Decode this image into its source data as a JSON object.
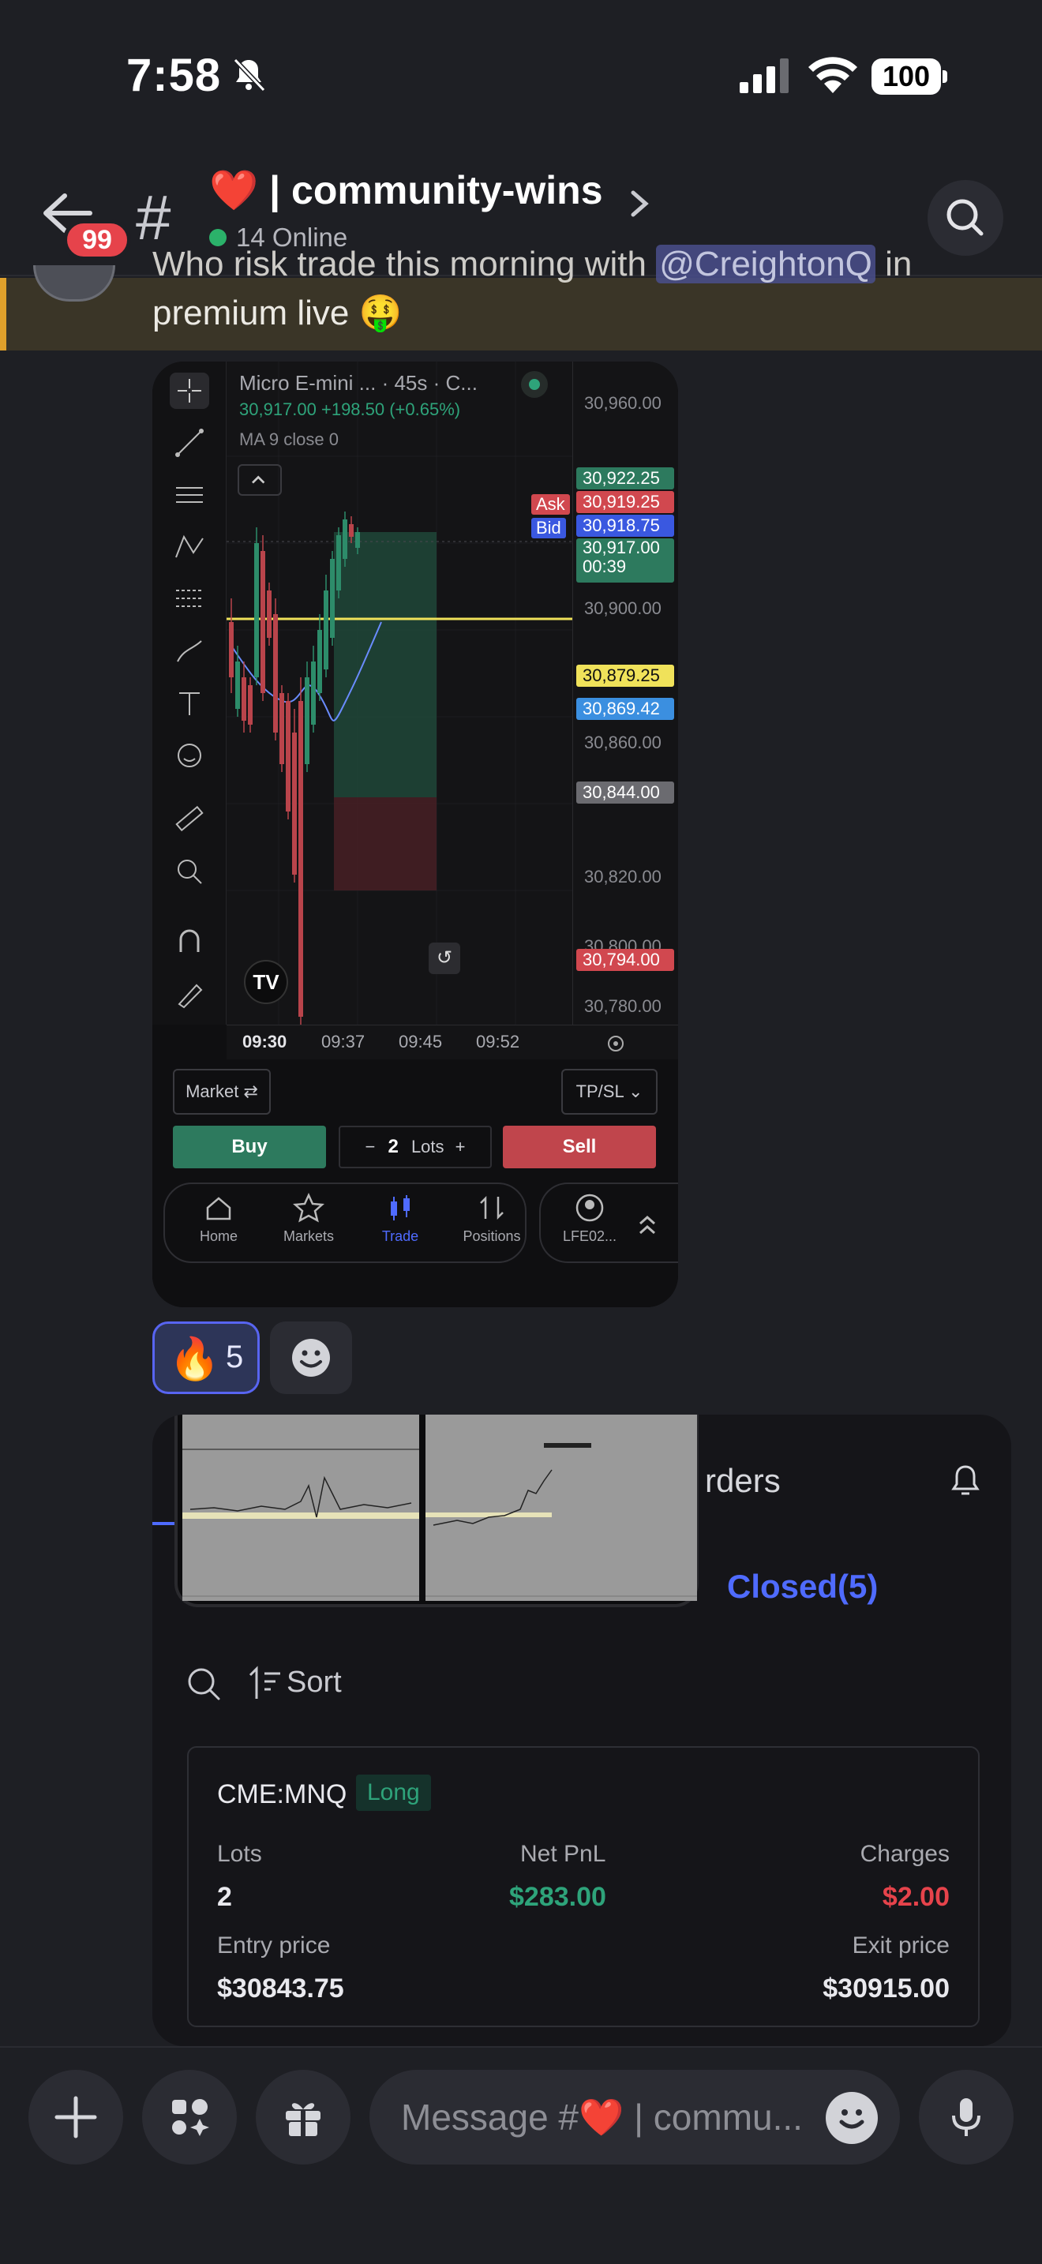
{
  "status_bar": {
    "time": "7:58",
    "battery": "100"
  },
  "header": {
    "unread_badge": "99",
    "channel_emoji": "❤️",
    "channel_name": "| community-wins",
    "online": "14 Online"
  },
  "message": {
    "line1_before": "Who risk trade this morning with ",
    "mention": "@CreightonQ",
    "line1_after": " in",
    "line2": "premium live 🤑"
  },
  "chart_shot": {
    "instrument": "Micro E-mini ...  · 45s · C...",
    "change": "30,917.00  +198.50 (+0.65%)",
    "ma_label": "MA 9 close 0",
    "price_ticks": [
      "30,960.00",
      "30,900.00",
      "30,860.00",
      "30,820.00",
      "30,800.00",
      "30,780.00"
    ],
    "tag_upper": "30,922.25",
    "ask_label": "Ask",
    "ask_price": "30,919.25",
    "bid_label": "Bid",
    "bid_price": "30,918.75",
    "last_price": "30,917.00",
    "countdown": "00:39",
    "yellow_line_price": "30,879.25",
    "blue_line_price": "30,869.42",
    "entry_price_tag": "30,844.00",
    "stop_price_tag": "30,794.00",
    "time_ticks": [
      "09:30",
      "09:37",
      "09:45",
      "09:52"
    ],
    "market_btn": "Market ⇄",
    "tpsl_btn": "TP/SL ⌄",
    "buy": "Buy",
    "sell": "Sell",
    "lots_value": "2",
    "lots_label": "Lots",
    "nav": [
      "Home",
      "Markets",
      "Trade",
      "Positions"
    ],
    "account": "LFE02..."
  },
  "reactions": {
    "fire_emoji": "🔥",
    "fire_count": "5"
  },
  "positions_shot": {
    "tab_text": "rders",
    "closed_tab": "Closed(5)",
    "sort_label": "Sort",
    "card": {
      "symbol": "CME:MNQ",
      "side": "Long",
      "lots_label": "Lots",
      "lots_value": "2",
      "pnl_label": "Net PnL",
      "pnl_value": "$283.00",
      "charges_label": "Charges",
      "charges_value": "$2.00",
      "entry_label": "Entry price",
      "entry_value": "$30843.75",
      "exit_label": "Exit price",
      "exit_value": "$30915.00"
    }
  },
  "composer": {
    "placeholder": "Message #❤️ | commu..."
  },
  "colors": {
    "accent": "#5865f2",
    "green": "#2ea37a",
    "red": "#e6434b",
    "mention_bg": "#4a4f8c",
    "highlight_bar": "#e0a12b"
  }
}
